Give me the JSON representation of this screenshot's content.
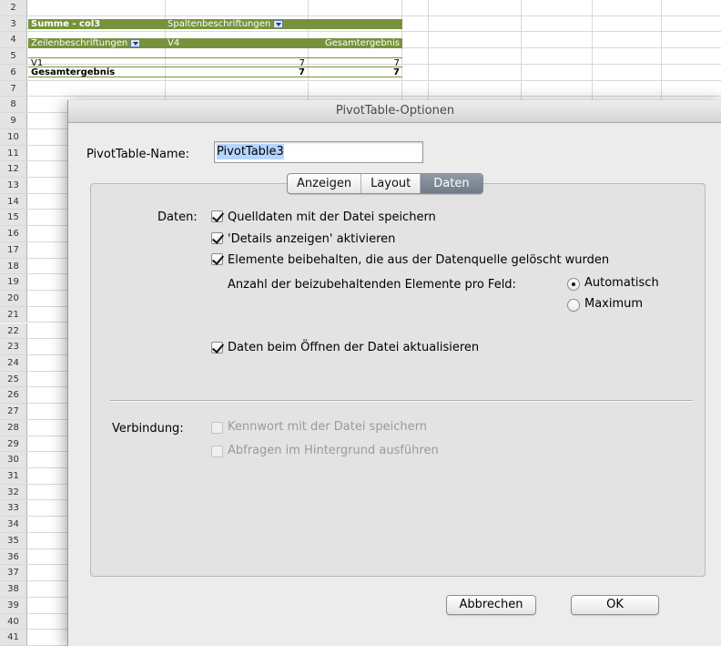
{
  "spreadsheet": {
    "row_numbers": [
      "2",
      "3",
      "4",
      "5",
      "6",
      "7",
      "8",
      "9",
      "10",
      "11",
      "12",
      "13",
      "14",
      "15",
      "16",
      "17",
      "18",
      "19",
      "20",
      "21",
      "22",
      "23",
      "24",
      "25",
      "26",
      "27",
      "28",
      "29",
      "30",
      "31",
      "32",
      "33",
      "34",
      "35",
      "36",
      "37",
      "38",
      "39",
      "40",
      "41"
    ],
    "pivot": {
      "r3_a": "Summe - col3",
      "r3_b": "Spaltenbeschriftungen",
      "r4_a": "Zeilenbeschriftungen",
      "r4_b": "V4",
      "r4_c": "Gesamtergebnis",
      "r5_a": "V1",
      "r5_b": "7",
      "r5_c": "7",
      "r6_a": "Gesamtergebnis",
      "r6_b": "7",
      "r6_c": "7"
    },
    "header_color": "#76923c"
  },
  "dialog": {
    "title": "PivotTable-Optionen",
    "name_label": "PivotTable-Name:",
    "name_value": "PivotTable3",
    "tabs": [
      {
        "label": "Anzeigen",
        "active": false
      },
      {
        "label": "Layout",
        "active": false
      },
      {
        "label": "Daten",
        "active": true
      }
    ],
    "daten_label": "Daten:",
    "options": {
      "save_source": {
        "label": "Quelldaten mit der Datei speichern",
        "checked": true
      },
      "show_details": {
        "label": "'Details anzeigen' aktivieren",
        "checked": true
      },
      "retain_items": {
        "label": "Elemente beibehalten, die aus der Datenquelle gelöscht wurden",
        "checked": true
      },
      "items_per_field_label": "Anzahl der beizubehaltenden Elemente pro Feld:",
      "radio_auto": {
        "label": "Automatisch",
        "selected": true
      },
      "radio_max": {
        "label": "Maximum",
        "selected": false
      },
      "refresh_on_open": {
        "label": "Daten beim Öffnen der Datei aktualisieren",
        "checked": true
      }
    },
    "connection_label": "Verbindung:",
    "connection": {
      "save_password": {
        "label": "Kennwort mit der Datei speichern",
        "checked": false,
        "enabled": false
      },
      "background_query": {
        "label": "Abfragen im Hintergrund ausführen",
        "checked": false,
        "enabled": false
      }
    },
    "buttons": {
      "cancel": "Abbrechen",
      "ok": "OK"
    }
  }
}
